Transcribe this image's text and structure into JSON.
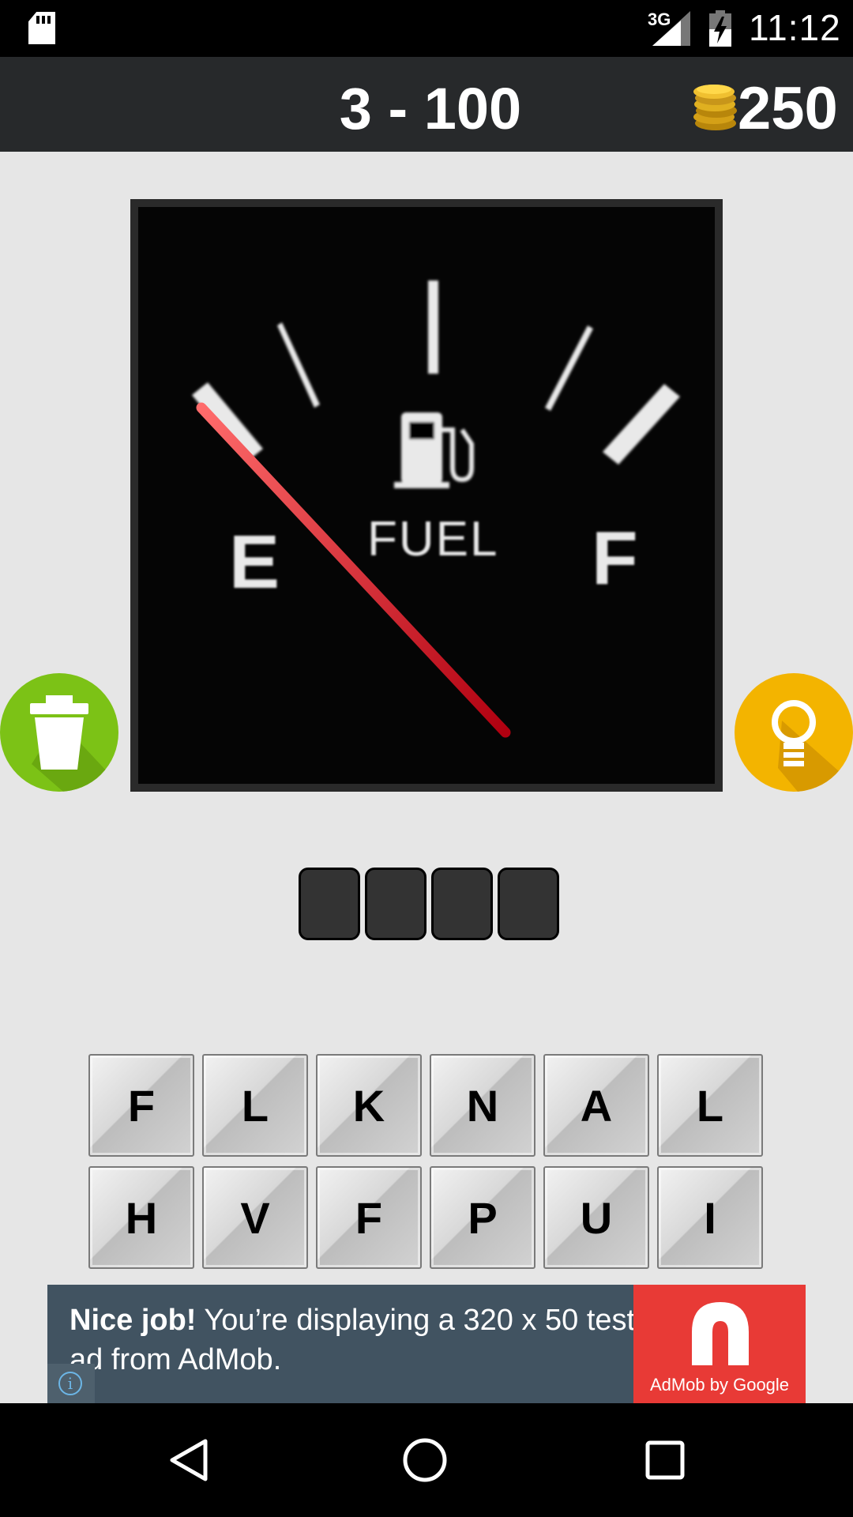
{
  "status_bar": {
    "network": "3G",
    "time": "11:12",
    "icons": [
      "sd-card-icon",
      "signal-icon",
      "battery-charging-icon"
    ]
  },
  "header": {
    "level": "3 - 100",
    "coins": "250",
    "coins_icon": "coins-icon"
  },
  "puzzle_image": {
    "letters": {
      "empty": "E",
      "full": "F"
    },
    "label": "FUEL",
    "icon": "fuel-pump-icon"
  },
  "side_buttons": {
    "left": {
      "icon": "trash-icon",
      "color": "#7cc216"
    },
    "right": {
      "icon": "lightbulb-icon",
      "color": "#f3b400"
    }
  },
  "answer_slots": [
    "",
    "",
    "",
    ""
  ],
  "letter_keys": {
    "row1": [
      "F",
      "L",
      "K",
      "N",
      "A",
      "L"
    ],
    "row2": [
      "H",
      "V",
      "F",
      "P",
      "U",
      "I"
    ]
  },
  "ad": {
    "bold": "Nice job!",
    "text": " You’re displaying a 320 x 50 test ad from AdMob.",
    "logo_label": "AdMob by Google",
    "info_icon": "info-icon",
    "brand_color": "#e83a36"
  },
  "nav_bar": {
    "icons": [
      "back-icon",
      "home-icon",
      "recents-icon"
    ]
  }
}
